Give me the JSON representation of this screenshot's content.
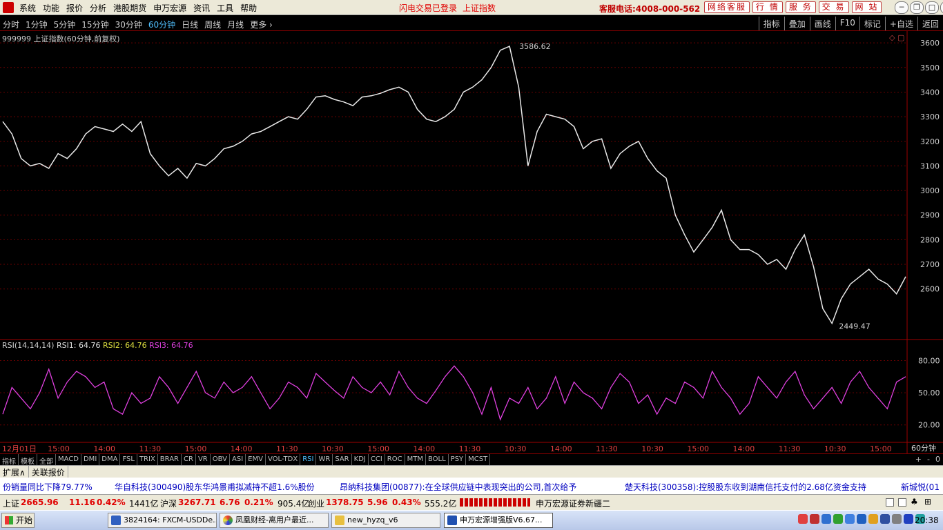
{
  "menubar": {
    "items": [
      "系统",
      "功能",
      "报价",
      "分析",
      "港股期货",
      "申万宏源",
      "资讯",
      "工具",
      "帮助"
    ],
    "login_status": "闪电交易已登录",
    "index_name": "上证指数",
    "service_phone": "客服电话:4008-000-562",
    "buttons": [
      "网络客服",
      "行 情",
      "服 务",
      "交 易",
      "网 站"
    ],
    "window_controls": [
      "─",
      "❐",
      "□",
      "✕"
    ]
  },
  "periodbar": {
    "periods": [
      "分时",
      "1分钟",
      "5分钟",
      "15分钟",
      "30分钟",
      "60分钟",
      "日线",
      "周线",
      "月线",
      "更多 ›"
    ],
    "active_index": 5,
    "tools": [
      "指标",
      "叠加",
      "画线",
      "F10",
      "标记",
      "+自选",
      "返回"
    ]
  },
  "chart_header": {
    "title": "999999 上证指数(60分钟,前复权)"
  },
  "rsi_header": {
    "name": "RSI(14,14,14)",
    "rsi1": "RSI1: 64.76",
    "rsi2": "RSI2: 64.76",
    "rsi3": "RSI3: 64.76"
  },
  "chart_data": {
    "type": "line",
    "price_axis": {
      "ticks": [
        3600,
        3500,
        3400,
        3300,
        3200,
        3100,
        3000,
        2900,
        2800,
        2700,
        2600
      ],
      "min": 2400,
      "max": 3620,
      "high_label": "3586.62",
      "low_label": "2449.47",
      "high_value": 3586.62,
      "low_value": 2449.47
    },
    "rsi_axis": {
      "ticks": [
        "80.00",
        "50.00",
        "20.00"
      ]
    },
    "x_ticks": [
      "12月01日",
      "15:00",
      "14:00",
      "11:30",
      "15:00",
      "14:00",
      "11:30",
      "10:30",
      "15:00",
      "14:00",
      "11:30",
      "10:30",
      "14:00",
      "11:30",
      "10:30",
      "15:00",
      "14:00",
      "11:30",
      "10:30",
      "15:00"
    ],
    "period_label": "60分钟",
    "series": [
      {
        "values": [
          3280,
          3230,
          3130,
          3100,
          3110,
          3090,
          3150,
          3130,
          3170,
          3230,
          3260,
          3250,
          3240,
          3270,
          3240,
          3280,
          3150,
          3100,
          3060,
          3090,
          3050,
          3110,
          3100,
          3130,
          3170,
          3180,
          3200,
          3230,
          3240,
          3260,
          3280,
          3300,
          3290,
          3330,
          3380,
          3385,
          3370,
          3360,
          3345,
          3380,
          3385,
          3395,
          3410,
          3420,
          3400,
          3330,
          3290,
          3280,
          3300,
          3330,
          3400,
          3420,
          3450,
          3500,
          3570,
          3586,
          3420,
          3100,
          3240,
          3310,
          3300,
          3290,
          3260,
          3170,
          3200,
          3210,
          3090,
          3150,
          3180,
          3200,
          3130,
          3080,
          3050,
          2900,
          2820,
          2750,
          2800,
          2850,
          2920,
          2800,
          2760,
          2760,
          2740,
          2700,
          2720,
          2680,
          2760,
          2820,
          2690,
          2520,
          2460,
          2560,
          2620,
          2650,
          2680,
          2640,
          2620,
          2580,
          2650
        ]
      },
      {
        "values": [
          30,
          55,
          45,
          35,
          50,
          72,
          45,
          60,
          70,
          65,
          55,
          60,
          35,
          30,
          50,
          40,
          45,
          65,
          55,
          40,
          55,
          70,
          50,
          45,
          60,
          50,
          55,
          65,
          50,
          35,
          45,
          60,
          55,
          45,
          68,
          60,
          52,
          45,
          65,
          55,
          50,
          60,
          48,
          70,
          55,
          45,
          40,
          52,
          65,
          75,
          65,
          50,
          30,
          55,
          25,
          45,
          40,
          55,
          35,
          45,
          65,
          40,
          60,
          50,
          45,
          35,
          55,
          68,
          60,
          40,
          48,
          30,
          45,
          40,
          60,
          55,
          45,
          70,
          55,
          45,
          30,
          40,
          65,
          55,
          45,
          60,
          70,
          48,
          35,
          45,
          55,
          40,
          60,
          70,
          55,
          45,
          35,
          60,
          65
        ]
      }
    ]
  },
  "indicator_tabs": {
    "items": [
      "指标",
      "模板",
      "全部",
      "MACD",
      "DMI",
      "DMA",
      "FSL",
      "TRIX",
      "BRAR",
      "CR",
      "VR",
      "OBV",
      "ASI",
      "EMV",
      "VOL-TDX",
      "RSI",
      "WR",
      "SAR",
      "KDJ",
      "CCI",
      "ROC",
      "MTM",
      "BOLL",
      "PSY",
      "MCST"
    ],
    "active": "RSI",
    "right": [
      "+",
      "-",
      "0"
    ]
  },
  "extbar": {
    "items": [
      "扩展∧",
      "关联报价"
    ]
  },
  "ticker": {
    "items": [
      "份销量同比下降79.77%",
      "华自科技(300490)股东华鸿景甫拟减持不超1.6%股份",
      "昂纳科技集团(00877):在全球供应链中表现突出的公司,首次给予",
      "楚天科技(300358):控股股东收到湖南信托支付的2.68亿资金支持",
      "新城悦(01"
    ]
  },
  "statusbar": {
    "sh_label": "上证",
    "sh_value": "2665.96",
    "sh_change": "11.16",
    "sh_pct": "0.42%",
    "sh_amount": "1441亿",
    "sz_label": "沪深",
    "sz_value": "3267.71",
    "sz_change": "6.76",
    "sz_pct": "0.21%",
    "sz_amount": "905.4亿",
    "cy_label": "创业",
    "cy_value": "1378.75",
    "cy_change": "5.96",
    "cy_pct": "0.43%",
    "cy_amount": "555.2亿",
    "server": "申万宏源证券新疆二"
  },
  "taskbar": {
    "start": "开始",
    "tasks": [
      "3824164: FXCM-USDDe...",
      "凤凰财经-离用户最近...",
      "new_hyzq_v6",
      "申万宏源增强版V6.67..."
    ],
    "clock": "20:38"
  }
}
